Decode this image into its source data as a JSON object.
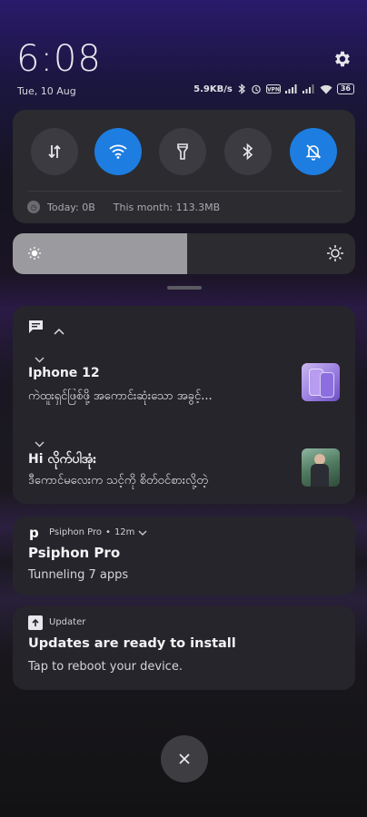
{
  "status": {
    "time": "6:08",
    "date": "Tue, 10 Aug",
    "net_speed": "5.9KB/s",
    "battery": "36"
  },
  "quick_settings": {
    "toggles": [
      {
        "name": "mobile-data",
        "icon": "data-arrows-icon",
        "active": false
      },
      {
        "name": "wifi",
        "icon": "wifi-icon",
        "active": true
      },
      {
        "name": "flashlight",
        "icon": "flashlight-icon",
        "active": false
      },
      {
        "name": "bluetooth",
        "icon": "bluetooth-icon",
        "active": false
      },
      {
        "name": "silent",
        "icon": "bell-off-icon",
        "active": true
      }
    ],
    "data_today": "Today: 0B",
    "data_month": "This month: 113.3MB"
  },
  "brightness": {
    "level": 0.51
  },
  "notifications": {
    "messages": [
      {
        "title": "Iphone 12",
        "text": "ကဲထူးရှင်ဖြစ်ဖို့ အကောင်းဆုံးသော အခွင့်..."
      },
      {
        "title": "Hi လိုက်ပါအုံး",
        "text": "ဒီကောင်မလေးက သင့်ကို စိတ်ဝင်စားလို့တဲ့"
      }
    ],
    "psiphon": {
      "app_name": "Psiphon Pro",
      "time": "12m",
      "title": "Psiphon Pro",
      "text": "Tunneling 7 apps"
    },
    "updater": {
      "app_name": "Updater",
      "title": "Updates are ready to install",
      "text": "Tap to reboot your device."
    }
  },
  "colors": {
    "accent": "#1d7de0",
    "card": "#26252b",
    "panel": "#2b2b30"
  }
}
